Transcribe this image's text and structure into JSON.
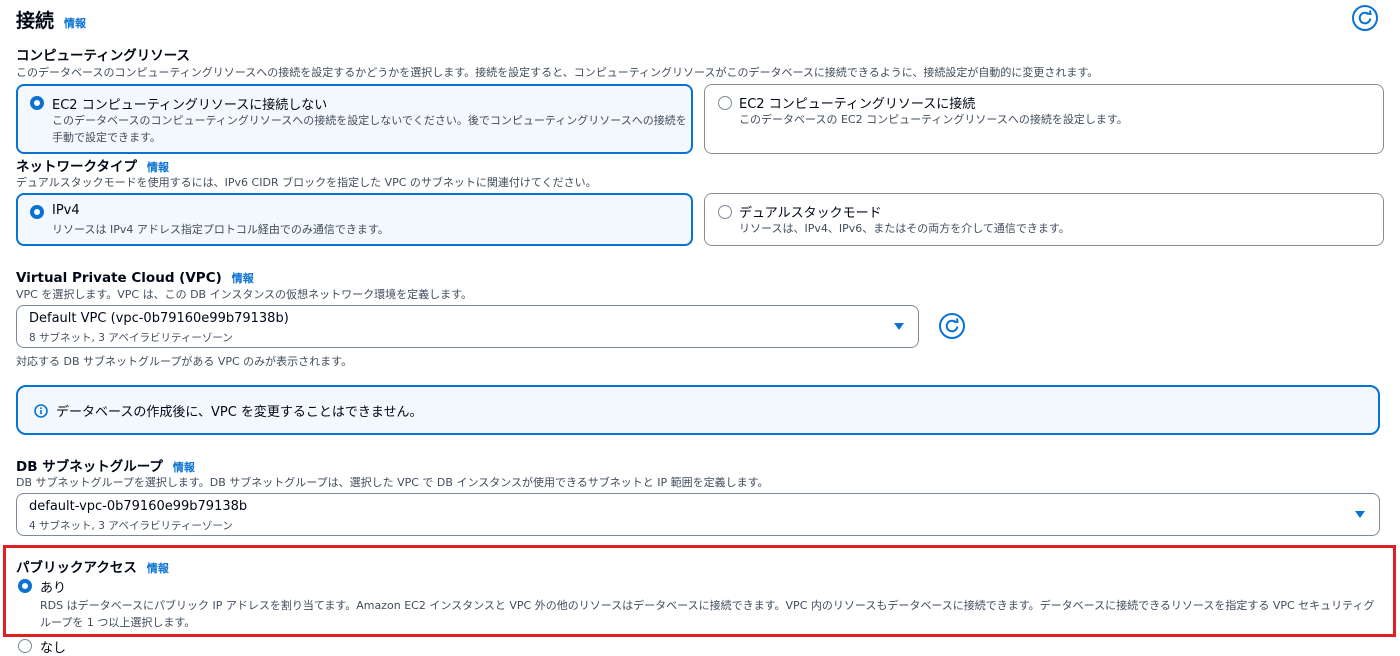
{
  "connection": {
    "title": "接続",
    "info": "情報"
  },
  "compute": {
    "label": "コンピューティングリソース",
    "description": "このデータベースのコンピューティングリソースへの接続を設定するかどうかを選択します。接続を設定すると、コンピューティングリソースがこのデータベースに接続できるように、接続設定が自動的に変更されます。",
    "options": [
      {
        "title": "EC2 コンピューティングリソースに接続しない",
        "description": "このデータベースのコンピューティングリソースへの接続を設定しないでください。後でコンピューティングリソースへの接続を手動で設定できます。",
        "selected": true
      },
      {
        "title": "EC2 コンピューティングリソースに接続",
        "description": "このデータベースの EC2 コンピューティングリソースへの接続を設定します。",
        "selected": false
      }
    ]
  },
  "network": {
    "label": "ネットワークタイプ",
    "info": "情報",
    "description": "デュアルスタックモードを使用するには、IPv6 CIDR ブロックを指定した VPC のサブネットに関連付けてください。",
    "options": [
      {
        "title": "IPv4",
        "description": "リソースは IPv4 アドレス指定プロトコル経由でのみ通信できます。",
        "selected": true
      },
      {
        "title": "デュアルスタックモード",
        "description": "リソースは、IPv4、IPv6、またはその両方を介して通信できます。",
        "selected": false
      }
    ]
  },
  "vpc": {
    "label": "Virtual Private Cloud (VPC)",
    "info": "情報",
    "description": "VPC を選択します。VPC は、この DB インスタンスの仮想ネットワーク環境を定義します。",
    "selected": "Default VPC (vpc-0b79160e99b79138b)",
    "sub": "8 サブネット, 3 アベイラビリティーゾーン",
    "hint": "対応する DB サブネットグループがある VPC のみが表示されます。"
  },
  "alert": {
    "text": "データベースの作成後に、VPC を変更することはできません。"
  },
  "subnet": {
    "label": "DB サブネットグループ",
    "info": "情報",
    "description": "DB サブネットグループを選択します。DB サブネットグループは、選択した VPC で DB インスタンスが使用できるサブネットと IP 範囲を定義します。",
    "selected": "default-vpc-0b79160e99b79138b",
    "sub": "4 サブネット, 3 アベイラビリティーゾーン"
  },
  "public_access": {
    "label": "パブリックアクセス",
    "info": "情報",
    "options": [
      {
        "title": "あり",
        "description": "RDS はデータベースにパブリック IP アドレスを割り当てます。Amazon EC2 インスタンスと VPC 外の他のリソースはデータベースに接続できます。VPC 内のリソースもデータベースに接続できます。データベースに接続できるリソースを指定する VPC セキュリティグループを 1 つ以上選択します。",
        "selected": true
      },
      {
        "title": "なし",
        "selected": false
      }
    ]
  },
  "colors": {
    "accent": "#0972d3",
    "highlight": "#e02020"
  }
}
